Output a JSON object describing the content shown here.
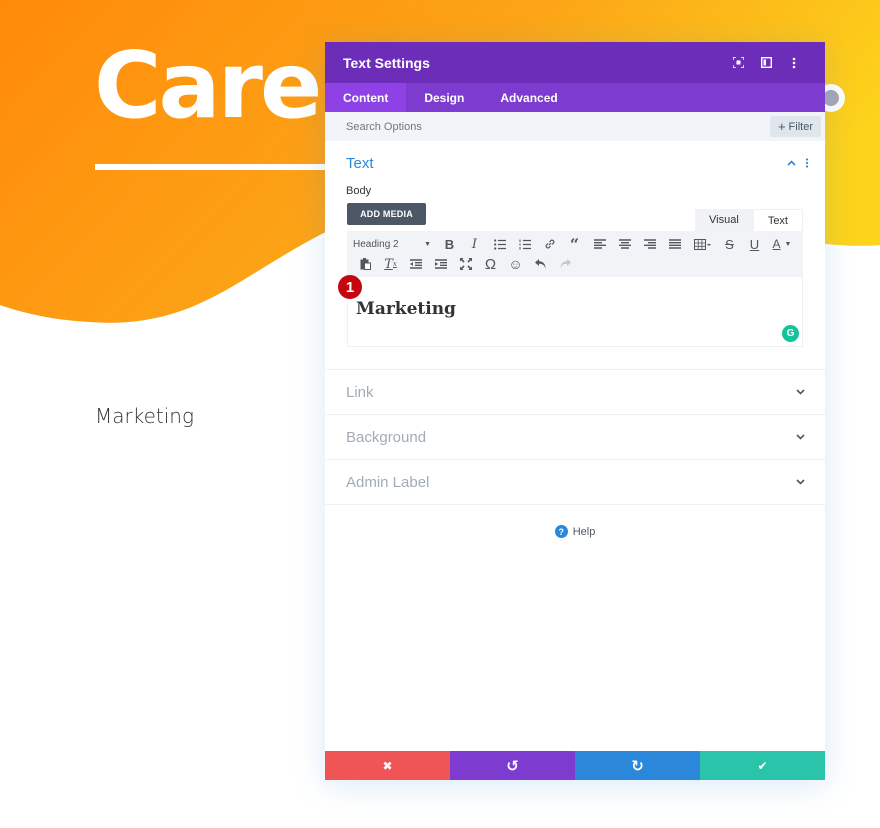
{
  "page": {
    "hero_title": "Care",
    "marketing_text": "Marketing",
    "colors": {
      "orange_start": "#ff8a0a",
      "orange_end": "#fdd31b",
      "header": "#6c2eb9",
      "tabs": "#7e3bd0",
      "active_tab": "#8e42e6",
      "accent": "#2b87da"
    }
  },
  "modal": {
    "title": "Text Settings",
    "header_icons": [
      "expand-icon",
      "sidebar-layout-icon",
      "more-vertical-icon"
    ],
    "tabs": [
      {
        "label": "Content",
        "active": true
      },
      {
        "label": "Design",
        "active": false
      },
      {
        "label": "Advanced",
        "active": false
      }
    ],
    "search": {
      "placeholder": "Search Options",
      "value": ""
    },
    "filter_label": "Filter",
    "text_section": {
      "title": "Text",
      "body_label": "Body",
      "add_media_label": "ADD MEDIA",
      "mode_tabs": [
        "Visual",
        "Text"
      ],
      "format_select": "Heading 2",
      "editor_content": "Marketing",
      "step_badge": "1"
    },
    "closed_sections": [
      {
        "title": "Link"
      },
      {
        "title": "Background"
      },
      {
        "title": "Admin Label"
      }
    ],
    "help_label": "Help",
    "footer": {
      "cancel": "✖",
      "undo": "↺",
      "redo": "↻",
      "save": "✔"
    }
  }
}
